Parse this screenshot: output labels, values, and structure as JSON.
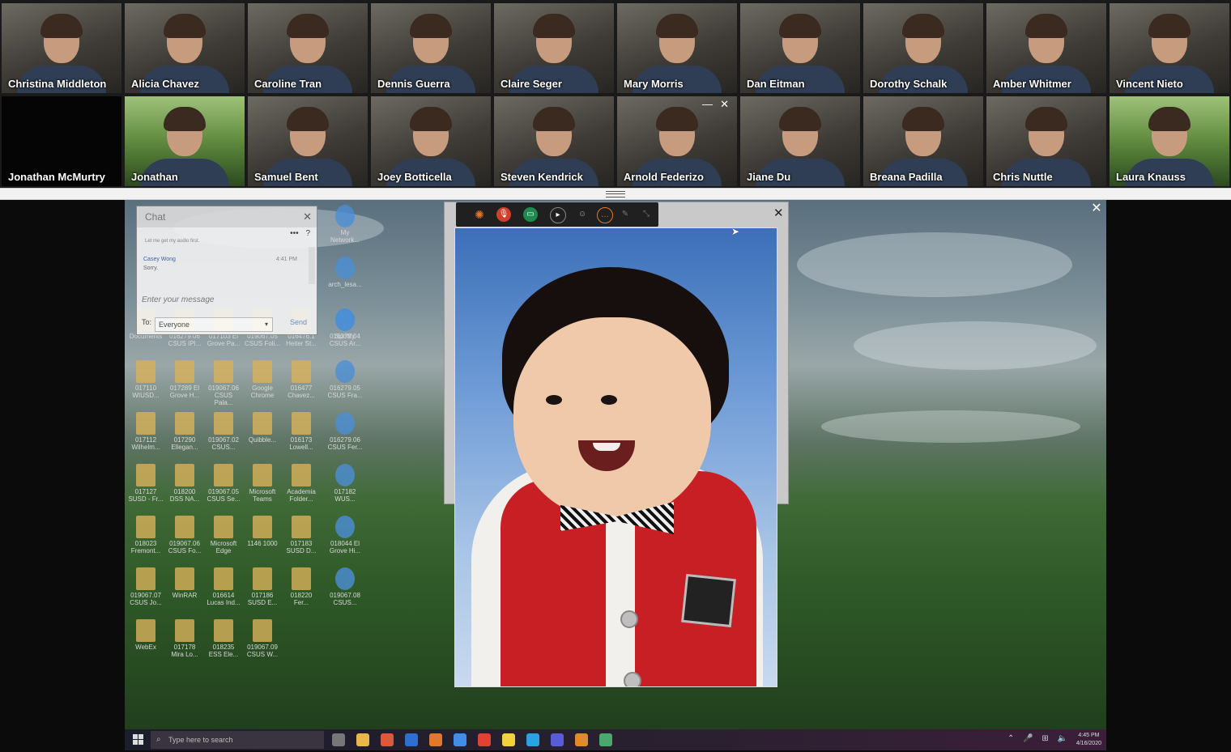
{
  "participants_top": [
    {
      "name": "Christina Middleton"
    },
    {
      "name": "Alicia Chavez"
    },
    {
      "name": "Caroline Tran"
    },
    {
      "name": "Dennis Guerra"
    },
    {
      "name": "Claire Seger"
    },
    {
      "name": "Mary Morris"
    },
    {
      "name": "Dan Eitman"
    },
    {
      "name": "Dorothy Schalk"
    },
    {
      "name": "Amber Whitmer"
    },
    {
      "name": "Vincent Nieto"
    }
  ],
  "participants_bottom": [
    {
      "name": "Jonathan McMurtry"
    },
    {
      "name": "Jonathan"
    },
    {
      "name": "Samuel Bent"
    },
    {
      "name": "Joey Botticella"
    },
    {
      "name": "Steven Kendrick"
    },
    {
      "name": "Arnold Federizo"
    },
    {
      "name": "Jiane Du"
    },
    {
      "name": "Breana Padilla"
    },
    {
      "name": "Chris Nuttle"
    },
    {
      "name": "Laura Knauss"
    }
  ],
  "tile_controls": {
    "close_glyph": "✕",
    "minimize_glyph": "—"
  },
  "share": {
    "close_glyph": "✕"
  },
  "chat": {
    "title": "Chat",
    "close_glyph": "✕",
    "more_glyph": "•••",
    "help_glyph": "?",
    "previous_line": "Let me get my audio first.",
    "message": {
      "sender": "Casey Wong",
      "time": "4:41 PM",
      "text": "Sorry."
    },
    "input_placeholder": "Enter your message",
    "to_label": "To:",
    "to_value": "Everyone",
    "send_label": "Send"
  },
  "viewer": {
    "close_glyph": "✕"
  },
  "toolbar": {
    "icons": [
      "webex-logo-icon",
      "mic-muted-icon",
      "share-screen-icon",
      "video-icon",
      "participants-icon",
      "chat-icon",
      "annotate-icon",
      "expand-icon"
    ]
  },
  "desktop_icons": [
    {
      "label": "My Network..."
    },
    {
      "label": "arch_lesa..."
    },
    {
      "label": "Spotify"
    },
    {
      "label": "Documents"
    },
    {
      "label": "016279.06 CSUS IPI..."
    },
    {
      "label": "017103 El Grove Pa..."
    },
    {
      "label": "019067.05 CSUS Foli..."
    },
    {
      "label": "016476.1 Heiter St..."
    },
    {
      "label": "016279.04 CSUS Ar..."
    },
    {
      "label": "017110 WIUSD..."
    },
    {
      "label": "017289 El Grove H..."
    },
    {
      "label": "019067.06 CSUS Pala..."
    },
    {
      "label": "Google Chrome"
    },
    {
      "label": "016477 Chavez..."
    },
    {
      "label": "016279.05 CSUS Fra..."
    },
    {
      "label": "017112 Wilhelm..."
    },
    {
      "label": "017290 Ellegan..."
    },
    {
      "label": "019067.02 CSUS..."
    },
    {
      "label": "Quibble..."
    },
    {
      "label": "016173 Lowell..."
    },
    {
      "label": "016279.06 CSUS Fer..."
    },
    {
      "label": "017127 SUSD - Fr..."
    },
    {
      "label": "018200 DSS NA..."
    },
    {
      "label": "019067.05 CSUS Se..."
    },
    {
      "label": "Microsoft Teams"
    },
    {
      "label": "Academia Folder..."
    },
    {
      "label": "017182 WUS..."
    },
    {
      "label": "018023 Fremont..."
    },
    {
      "label": "019067.06 CSUS Fo..."
    },
    {
      "label": "Microsoft Edge"
    },
    {
      "label": "1146 1000"
    },
    {
      "label": "017183 SUSD D..."
    },
    {
      "label": "018044 El Grove Hi..."
    },
    {
      "label": "019067.07 CSUS Jo..."
    },
    {
      "label": "WinRAR"
    },
    {
      "label": "016614 Lucas Ind..."
    },
    {
      "label": "017186 SUSD E..."
    },
    {
      "label": "018220 Fer..."
    },
    {
      "label": "019067.08 CSUS..."
    },
    {
      "label": "WebEx"
    },
    {
      "label": "017178 Mira Lo..."
    },
    {
      "label": "018235 ESS Ele..."
    },
    {
      "label": "019067.09 CSUS W..."
    }
  ],
  "taskbar": {
    "search_placeholder": "Type here to search",
    "clock_time": "4:45 PM",
    "clock_date": "4/16/2020",
    "apps": [
      "task-view-icon",
      "file-explorer-icon",
      "slack-icon",
      "outlook-icon",
      "snagit-icon",
      "todo-icon",
      "chrome-icon",
      "sticky-notes-icon",
      "skype-icon",
      "teams-icon",
      "webex-icon",
      "photos-icon"
    ]
  },
  "colors": {
    "accent_red": "#c81f24",
    "webex_green": "#1d8a4f",
    "taskbar": "#1a1d2a"
  }
}
